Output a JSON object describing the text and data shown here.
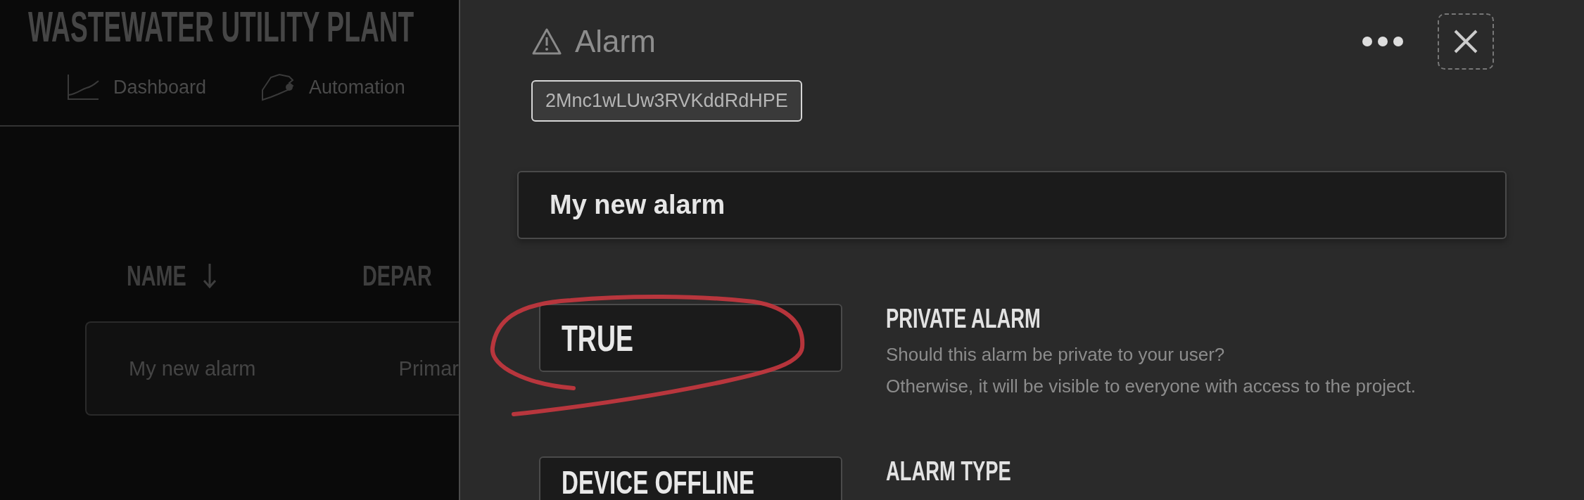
{
  "app": {
    "title": "WASTEWATER UTILITY PLANT",
    "nav": [
      {
        "label": "Dashboard",
        "selected": false
      },
      {
        "label": "Automation",
        "selected": false
      }
    ]
  },
  "table": {
    "columns": [
      {
        "label": "NAME",
        "sorted": true
      },
      {
        "label": "DEPAR",
        "sorted": false
      }
    ],
    "rows": [
      [
        "My new alarm",
        "Primar"
      ]
    ]
  },
  "panel": {
    "title": "Alarm",
    "id": "2Mnc1wLUw3RVKddRdHPE",
    "name": "My new alarm",
    "settings": [
      {
        "value": "TRUE",
        "label": "PRIVATE ALARM",
        "circled": true,
        "description": [
          "Should this alarm be private to your user?",
          "Otherwise, it will be visible to everyone with access to the project."
        ]
      },
      {
        "value": "DEVICE OFFLINE",
        "label": "ALARM TYPE",
        "circled": false
      }
    ]
  }
}
